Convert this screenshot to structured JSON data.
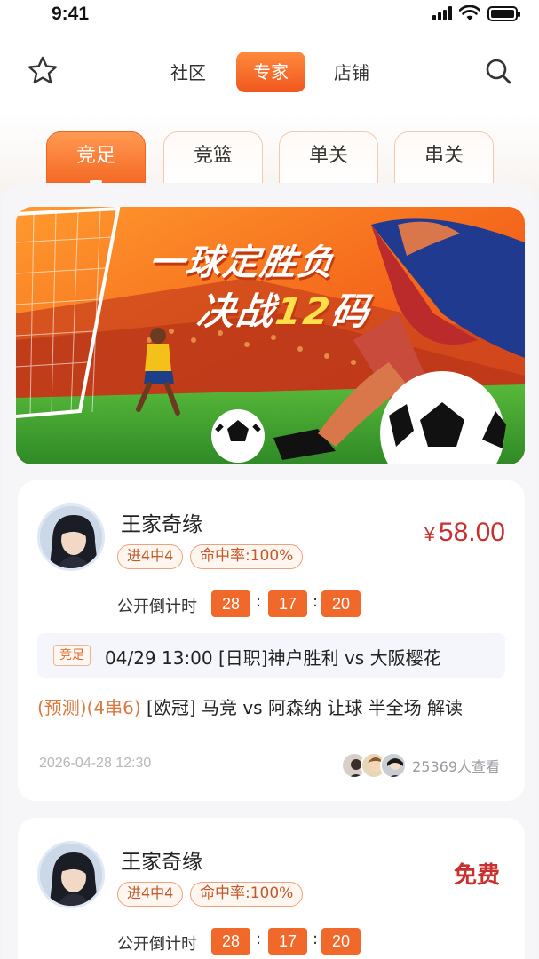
{
  "status_bar": {
    "time": "9:41"
  },
  "top_nav": {
    "tabs": [
      {
        "label": "社区",
        "active": false
      },
      {
        "label": "专家",
        "active": true
      },
      {
        "label": "店铺",
        "active": false
      }
    ]
  },
  "sport_tabs": [
    {
      "label": "竞足",
      "active": true
    },
    {
      "label": "竞篮",
      "active": false
    },
    {
      "label": "单关",
      "active": false
    },
    {
      "label": "串关",
      "active": false
    }
  ],
  "banner": {
    "title": "一球定胜负",
    "subtitle_prefix": "决战",
    "subtitle_highlight": "12",
    "subtitle_suffix": "码"
  },
  "cards": [
    {
      "expert_name": "王家奇缘",
      "streak_badge": "进4中4",
      "hit_rate_badge": "命中率:100%",
      "price_currency": "¥",
      "price_value": "58.00",
      "countdown_label": "公开倒计时",
      "countdown": [
        "28",
        "17",
        "20"
      ],
      "match_tag": "竞足",
      "match_text": "04/29 13:00 [日职]神户胜利 vs 大阪樱花",
      "forecast_prefix": "(预测)(4串6)",
      "forecast_text": " [欧冠] 马竞 vs 阿森纳 让球 半全场 解读",
      "time": "2026-04-28 12:30",
      "viewers": "25369人查看"
    },
    {
      "expert_name": "王家奇缘",
      "streak_badge": "进4中4",
      "hit_rate_badge": "命中率:100%",
      "price_label": "免费",
      "countdown_label": "公开倒计时",
      "countdown": [
        "28",
        "17",
        "20"
      ]
    }
  ],
  "colors": {
    "accent": "#f0571e",
    "price": "#c8312f",
    "badge_border": "#eda27f"
  },
  "icons": {
    "left": "star-icon",
    "right": "search-icon"
  }
}
